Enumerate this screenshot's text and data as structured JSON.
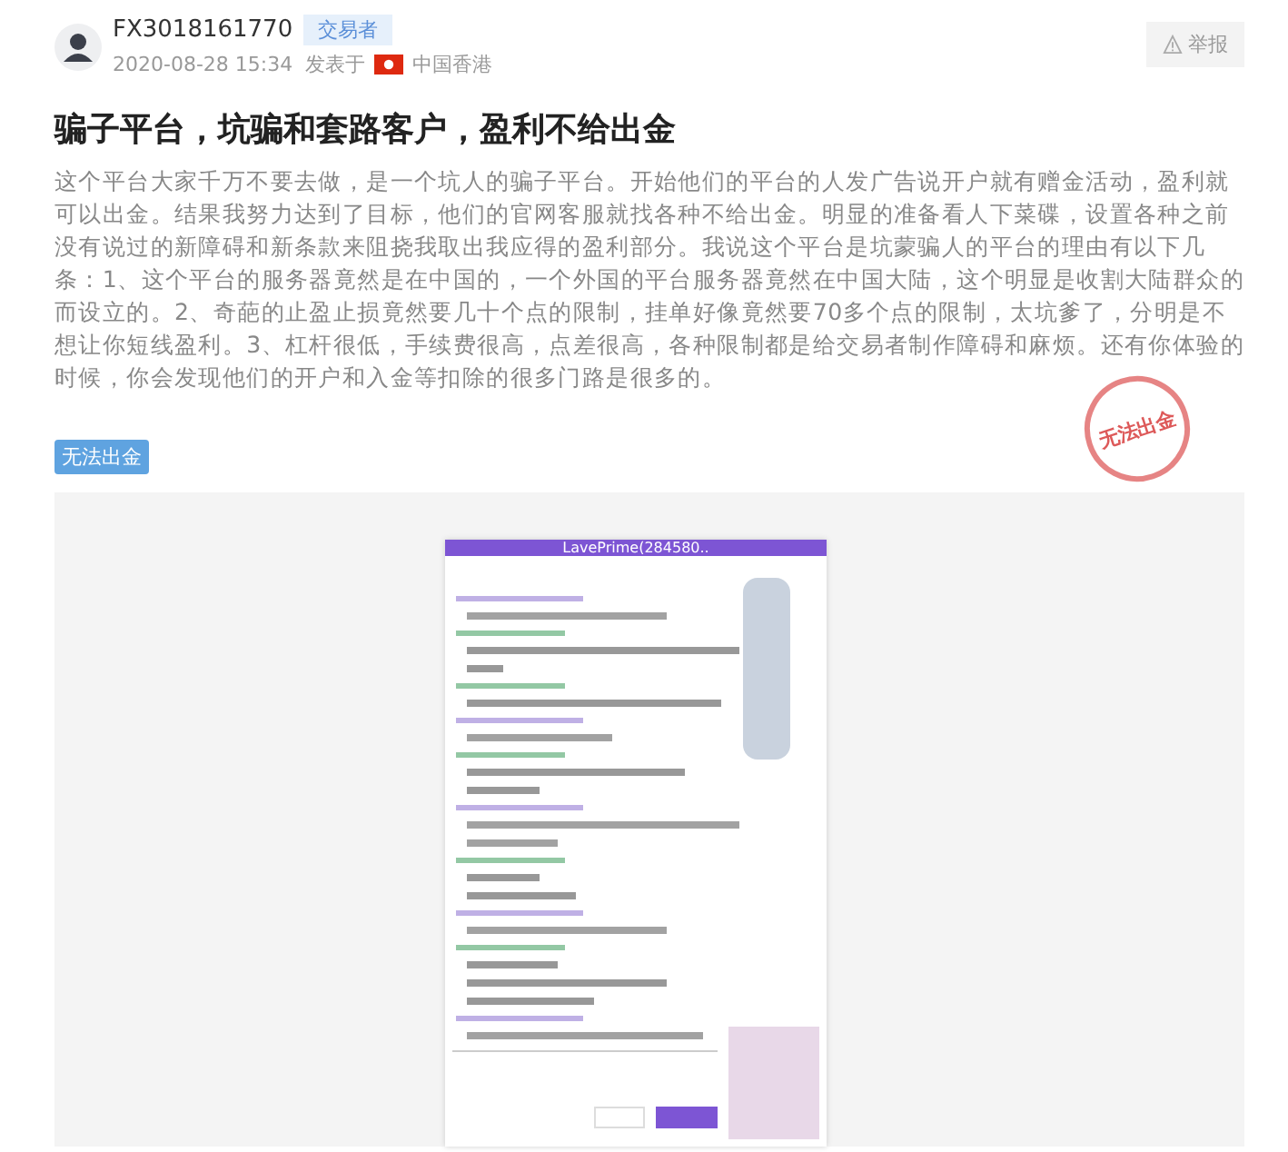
{
  "author": {
    "name": "FX3018161770",
    "role_badge": "交易者",
    "date": "2020-08-28 15:34",
    "posted_in": "发表于",
    "location": "中国香港"
  },
  "report_button": {
    "label": "举报"
  },
  "post": {
    "title": "骗子平台，坑骗和套路客户，盈利不给出金",
    "body": "这个平台大家千万不要去做，是一个坑人的骗子平台。开始他们的平台的人发广告说开户就有赠金活动，盈利就可以出金。结果我努力达到了目标，他们的官网客服就找各种不给出金。明显的准备看人下菜碟，设置各种之前没有说过的新障碍和新条款来阻挠我取出我应得的盈利部分。我说这个平台是坑蒙骗人的平台的理由有以下几条：1、这个平台的服务器竟然是在中国的，一个外国的平台服务器竟然在中国大陆，这个明显是收割大陆群众的而设立的。2、奇葩的止盈止损竟然要几十个点的限制，挂单好像竟然要70多个点的限制，太坑爹了，分明是不想让你短线盈利。3、杠杆很低，手续费很高，点差很高，各种限制都是给交易者制作障碍和麻烦。还有你体验的时候，你会发现他们的开户和入金等扣除的很多门路是很多的。",
    "tags": [
      "无法出金"
    ],
    "stamp": "无法出金"
  },
  "screenshot": {
    "window_title": "LavePrime(284580.."
  }
}
